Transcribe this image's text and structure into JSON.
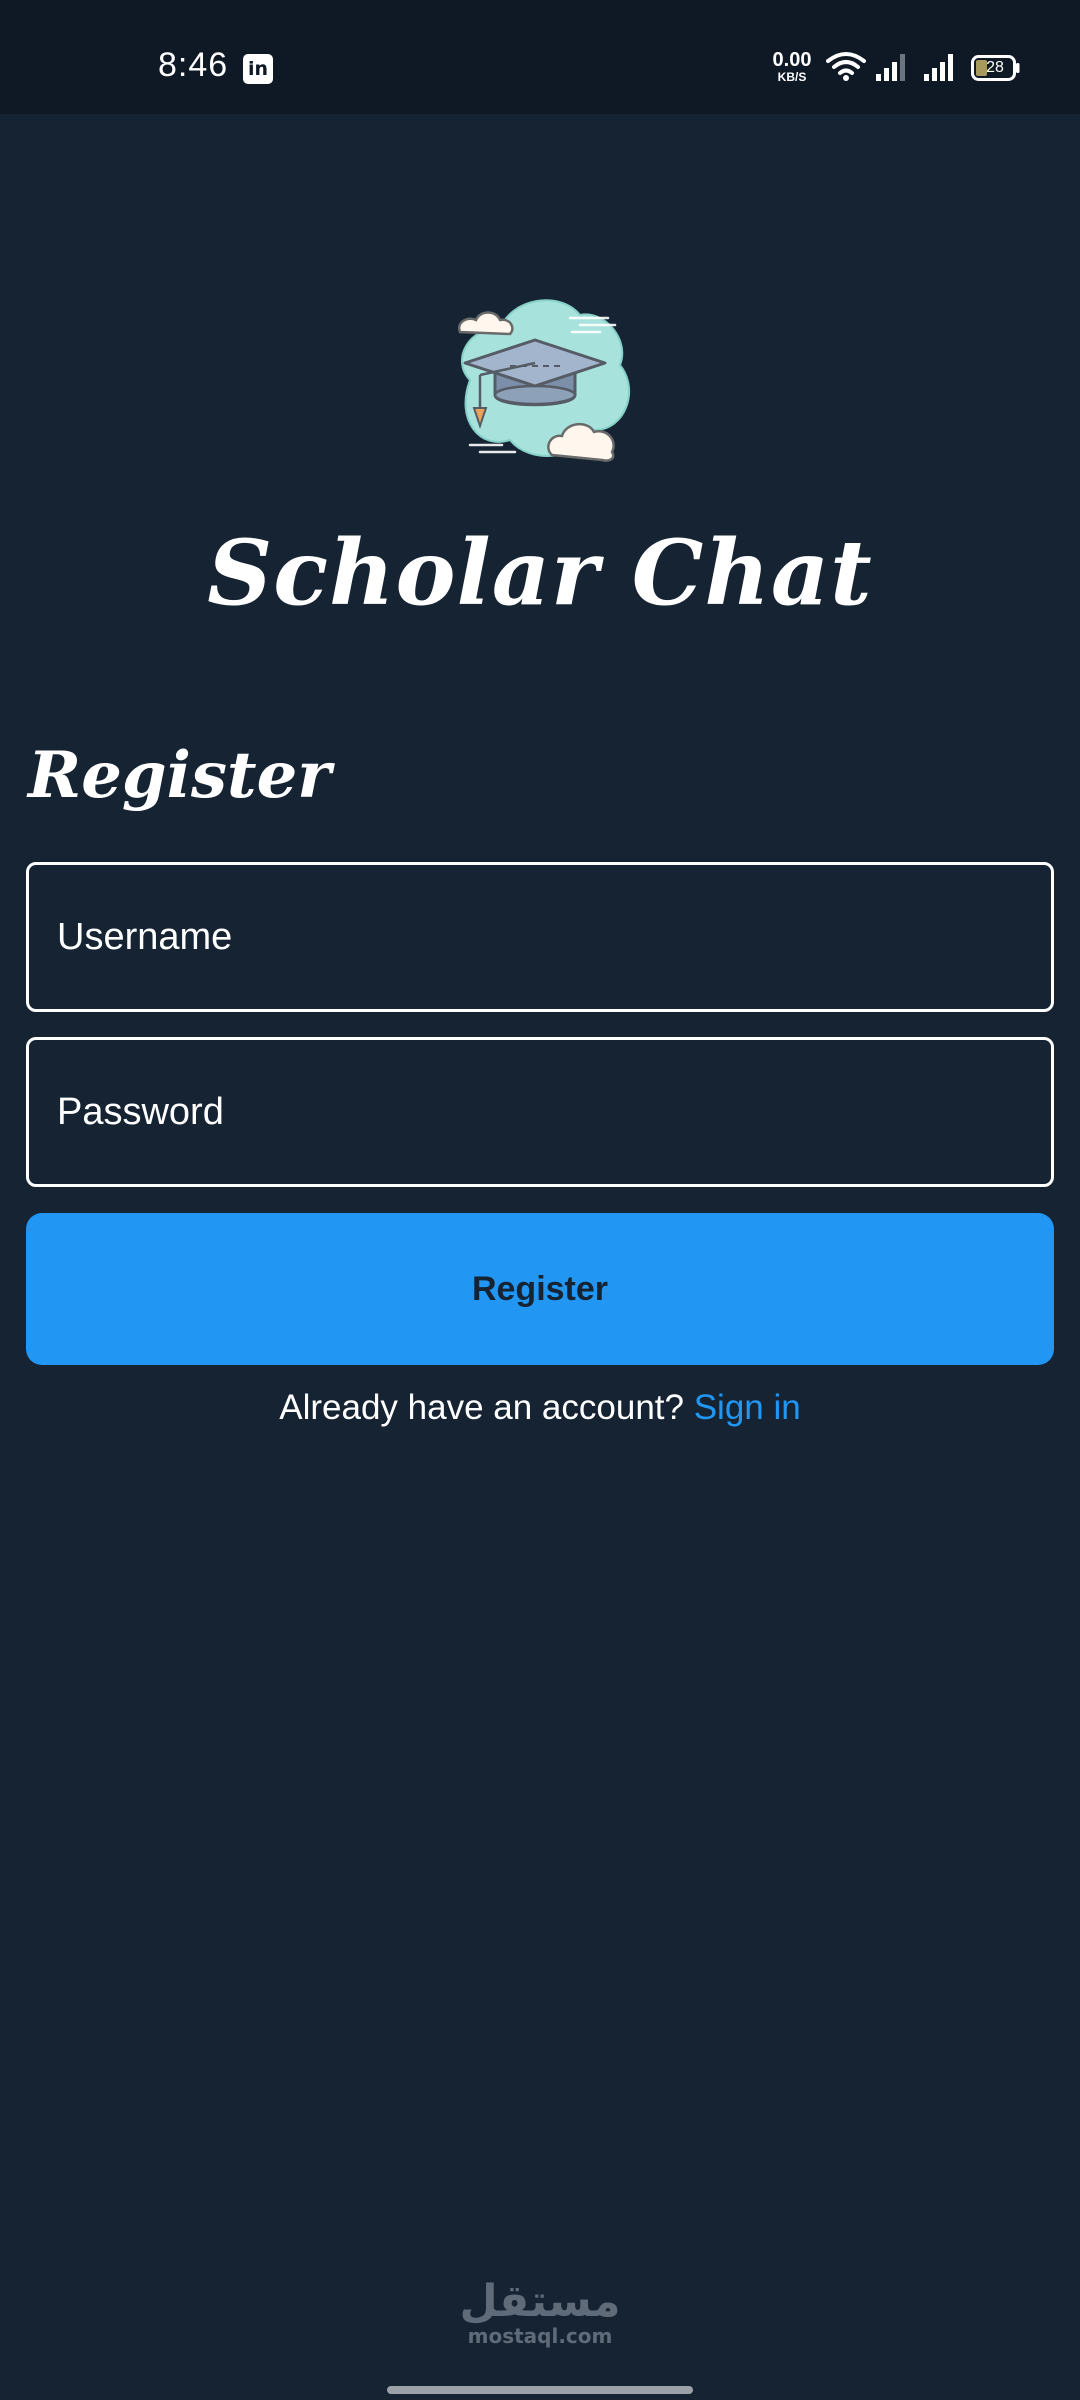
{
  "status_bar": {
    "time": "8:46",
    "notification_app": "in",
    "net_speed_value": "0.00",
    "net_speed_unit": "KB/S",
    "battery_level": "28",
    "icons": [
      "linkedin-icon",
      "wifi-icon",
      "signal-icon",
      "signal-icon",
      "battery-icon"
    ]
  },
  "app": {
    "title": "Scholar Chat",
    "logo_icon": "graduation-cap-cloud-icon"
  },
  "form": {
    "heading": "Register",
    "username_placeholder": "Username",
    "password_placeholder": "Password",
    "submit_label": "Register"
  },
  "footer": {
    "prompt": "Already have an account?",
    "signin_link": "Sign in"
  },
  "watermark": {
    "arabic": "مستقل",
    "latin": "mostaql.com"
  },
  "colors": {
    "background": "#152333",
    "status_bar": "#0f1926",
    "accent": "#2196f3",
    "text": "#ffffff"
  }
}
